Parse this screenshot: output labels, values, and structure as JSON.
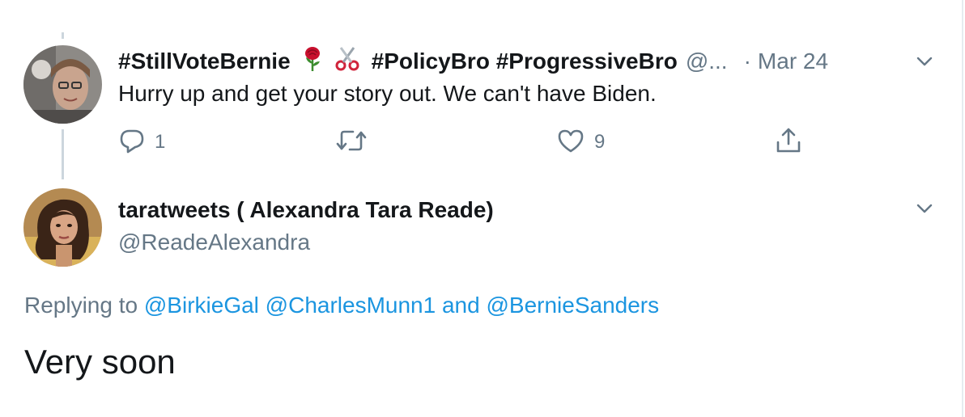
{
  "tweet_parent": {
    "display_name": "#StillVoteBernie",
    "name_emoji_1": "rose-emoji",
    "name_emoji_2": "scissors-emoji",
    "name_tags": "#PolicyBro #ProgressiveBro",
    "handle_truncated": "@...",
    "separator": "·",
    "date": "Mar 24",
    "text": "Hurry up and get your story out. We can't have Biden.",
    "actions": {
      "reply_icon": "reply-icon",
      "reply_count": "1",
      "retweet_icon": "retweet-icon",
      "retweet_count": "",
      "like_icon": "heart-icon",
      "like_count": "9",
      "share_icon": "share-icon"
    }
  },
  "tweet_main": {
    "display_name": "taratweets ( Alexandra Tara Reade)",
    "handle": "@ReadeAlexandra",
    "replying_prefix": "Replying to",
    "replying_to_1": "@BirkieGal",
    "replying_to_2": "@CharlesMunn1",
    "replying_and": "and",
    "replying_to_3": "@BernieSanders",
    "text": "Very soon"
  },
  "colors": {
    "text_primary": "#14171a",
    "text_secondary": "#657786",
    "link": "#1b95e0",
    "thread_line": "#ccd6dd",
    "border": "#e6ecf0"
  }
}
